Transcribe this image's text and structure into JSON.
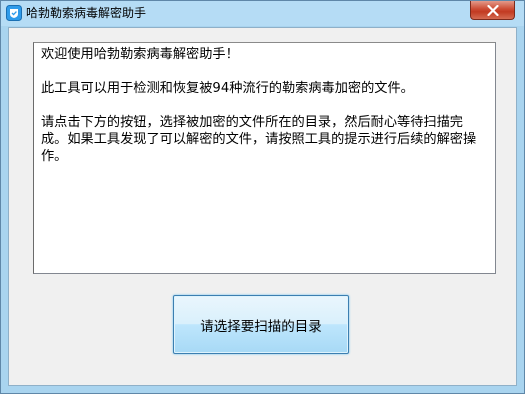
{
  "window": {
    "title": "哈勃勒索病毒解密助手",
    "icon": "app-shield-icon",
    "close_icon": "close-icon"
  },
  "textbox": {
    "lines": [
      "欢迎使用哈勃勒索病毒解密助手！",
      "此工具可以用于检测和恢复被94种流行的勒索病毒加密的文件。",
      "请点击下方的按钮，选择被加密的文件所在的目录，然后耐心等待扫描完成。如果工具发现了可以解密的文件，请按照工具的提示进行后续的解密操作。"
    ]
  },
  "button": {
    "label": "请选择要扫描的目录"
  },
  "colors": {
    "frame": "#a9d4ef",
    "titlebar": "#b5dcf5",
    "close_red": "#c23b22",
    "client_bg": "#f0f0f0",
    "button_border": "#3c7fb1"
  }
}
